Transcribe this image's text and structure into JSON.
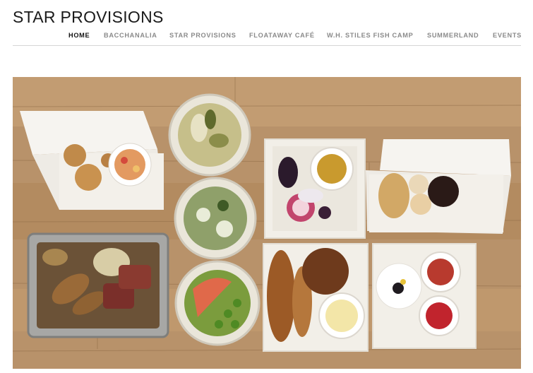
{
  "site": {
    "title": "STAR PROVISIONS"
  },
  "nav": {
    "items": [
      {
        "label": "HOME",
        "active": true
      },
      {
        "label": "BACCHANALIA",
        "active": false
      },
      {
        "label": "STAR PROVISIONS",
        "active": false
      },
      {
        "label": "FLOATAWAY CAFÉ",
        "active": false
      },
      {
        "label": "W.H. STILES FISH CAMP",
        "active": false
      },
      {
        "label": "SUMMERLAND",
        "active": false
      },
      {
        "label": "EVENTS",
        "active": false
      }
    ]
  },
  "hero": {
    "subject": "overhead photo of takeout meal containers on a wooden table"
  },
  "colors": {
    "title": "#1a1a1a",
    "nav_active": "#111111",
    "nav_inactive": "#8a8a8a",
    "rule": "#d6d6d6"
  }
}
